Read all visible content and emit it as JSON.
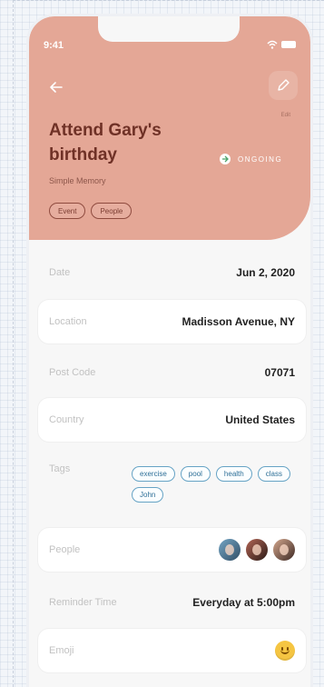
{
  "status_bar": {
    "time": "9:41"
  },
  "header": {
    "back_icon": "arrow-left-icon",
    "edit_icon": "pencil-icon",
    "edit_label": "Edit",
    "title": "Attend Gary's birthday",
    "subtitle": "Simple Memory",
    "status": "ONGOING",
    "chips": [
      "Event",
      "People"
    ],
    "colors": {
      "header_background": "#e4a796",
      "title": "#6f3126",
      "accent_blue": "#66a3c5"
    }
  },
  "details": {
    "date": {
      "label": "Date",
      "value": "Jun 2, 2020"
    },
    "location": {
      "label": "Location",
      "value": "Madisson Avenue, NY"
    },
    "post_code": {
      "label": "Post Code",
      "value": "07071"
    },
    "country": {
      "label": "Country",
      "value": "United States"
    },
    "tags": {
      "label": "Tags",
      "items": [
        "exercise",
        "pool",
        "health",
        "class",
        "John"
      ]
    },
    "people": {
      "label": "People"
    },
    "reminder": {
      "label": "Reminder Time",
      "value": "Everyday at 5:00pm"
    },
    "emoji": {
      "label": "Emoji",
      "icon": "smiley-face-icon"
    }
  }
}
